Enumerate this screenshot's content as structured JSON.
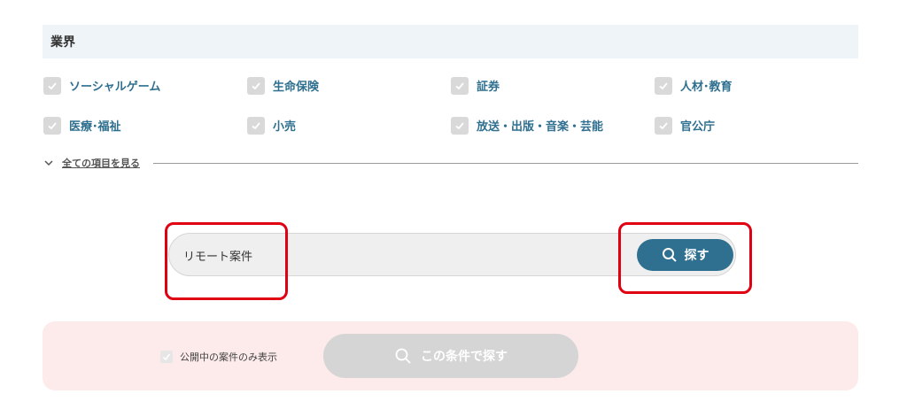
{
  "industry": {
    "title": "業界",
    "items": [
      {
        "label": "ソーシャルゲーム"
      },
      {
        "label": "生命保険"
      },
      {
        "label": "証券"
      },
      {
        "label": "人材･教育"
      },
      {
        "label": "医療･福祉"
      },
      {
        "label": "小売"
      },
      {
        "label": "放送・出版・音楽・芸能"
      },
      {
        "label": "官公庁"
      }
    ],
    "show_all_label": "全ての項目を見る"
  },
  "search": {
    "value": "リモート案件",
    "button_label": "探す"
  },
  "footer": {
    "public_only_label": "公開中の案件のみ表示",
    "condition_search_label": "この条件で探す"
  },
  "colors": {
    "accent": "#2f6f8f",
    "highlight": "#e00012",
    "footer_bg": "#fdeaea",
    "header_bg": "#eef4f8"
  }
}
